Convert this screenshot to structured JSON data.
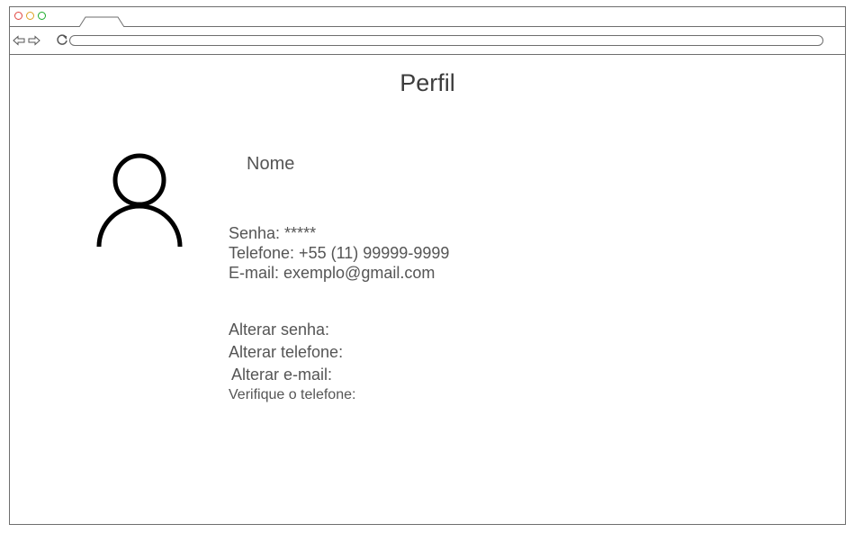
{
  "browser": {
    "window_controls": [
      "close-dot",
      "minimize-dot",
      "maximize-dot"
    ],
    "colors": {
      "close": "#e0443e",
      "minimize": "#dea123",
      "maximize": "#1aab29"
    },
    "nav_icons": [
      "back-arrow-icon",
      "forward-arrow-icon",
      "reload-icon"
    ],
    "address_bar_value": ""
  },
  "page": {
    "title": "Perfil",
    "avatar_icon": "user-icon",
    "name": "Nome",
    "info": {
      "password": "Senha: *****",
      "phone": "Telefone: +55 (11) 99999-9999",
      "email": "E-mail: exemplo@gmail.com"
    },
    "actions": {
      "change_password": "Alterar senha:",
      "change_phone": "Alterar telefone:",
      "change_email": "Alterar e-mail:",
      "verify_phone": "Verifique o telefone:"
    }
  }
}
